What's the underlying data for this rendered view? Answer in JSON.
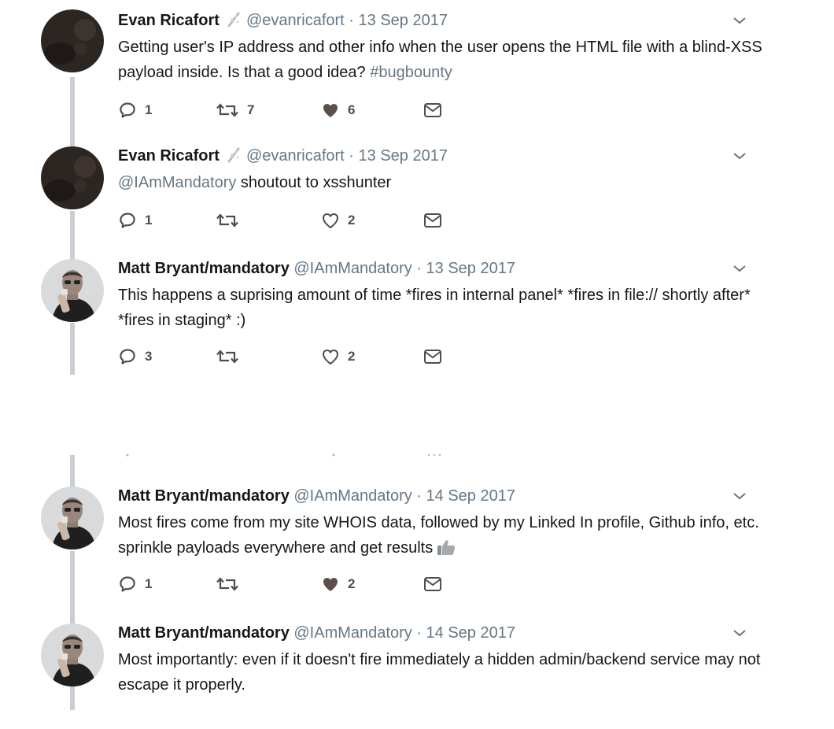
{
  "tweets": [
    {
      "name": "Evan Ricafort",
      "handle": "@evanricafort",
      "date": "13 Sep 2017",
      "text": "Getting user's IP address and other info when the user opens the HTML file with a blind-XSS payload inside. Is that a good idea?",
      "hashtag": "#bugbounty",
      "replies": "1",
      "retweets": "7",
      "likes": "6",
      "liked": true,
      "avatar": "dark-avatar"
    },
    {
      "name": "Evan Ricafort",
      "handle": "@evanricafort",
      "date": "13 Sep 2017",
      "mention": "@IAmMandatory",
      "text": "shoutout to xsshunter",
      "replies": "1",
      "retweets": "",
      "likes": "2",
      "liked": false,
      "avatar": "dark-avatar"
    },
    {
      "name": "Matt Bryant/mandatory",
      "handle": "@IAmMandatory",
      "date": "13 Sep 2017",
      "text": "This happens a suprising amount of time *fires in internal panel* *fires in file:// shortly after* *fires in staging* :)",
      "replies": "3",
      "retweets": "",
      "likes": "2",
      "liked": false,
      "avatar": "photo-avatar"
    },
    {
      "name": "Matt Bryant/mandatory",
      "handle": "@IAmMandatory",
      "date": "14 Sep 2017",
      "text": "Most fires come from my site WHOIS data, followed by my Linked In profile, Github info, etc. sprinkle payloads everywhere and get results",
      "emoji": "thumbs-up-icon",
      "replies": "1",
      "retweets": "",
      "likes": "2",
      "liked": true,
      "avatar": "photo-avatar"
    },
    {
      "name": "Matt Bryant/mandatory",
      "handle": "@IAmMandatory",
      "date": "14 Sep 2017",
      "text": "Most importantly: even if it doesn't fire immediately a hidden admin/backend service may not escape it properly.",
      "avatar": "photo-avatar"
    }
  ],
  "separator": "·",
  "colors": {
    "secondary": "#657786",
    "thread": "#c9ced3",
    "liked": "#5d4e4e"
  }
}
